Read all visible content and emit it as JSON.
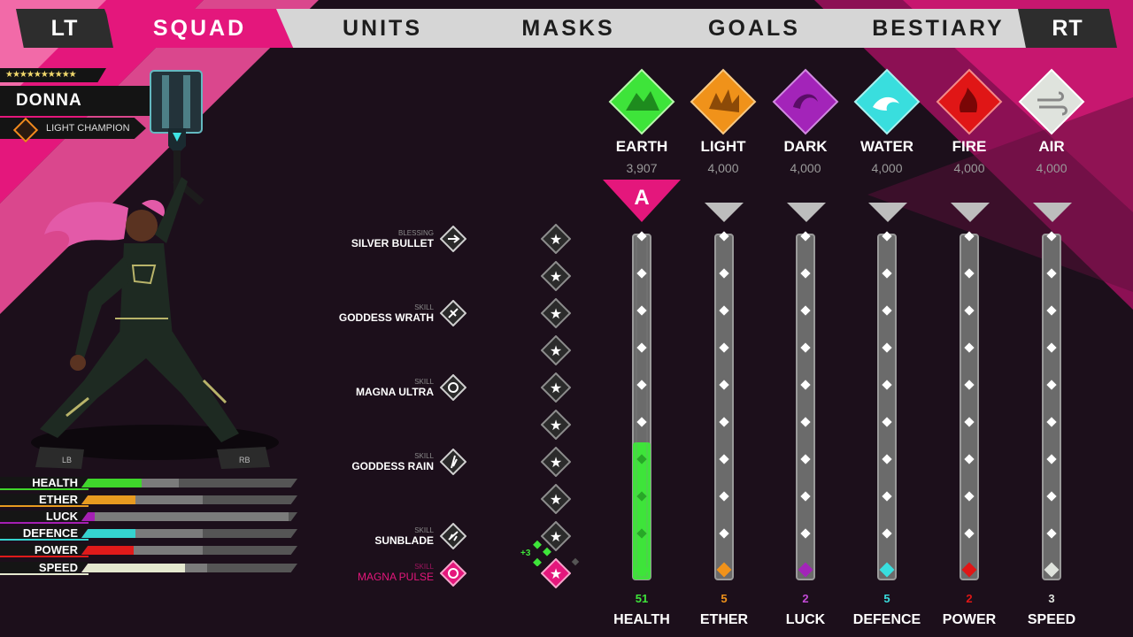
{
  "tabs": [
    {
      "label": "LT",
      "style": "dark"
    },
    {
      "label": "SQUAD",
      "style": "active"
    },
    {
      "label": "UNITS",
      "style": "light"
    },
    {
      "label": "MASKS",
      "style": "light"
    },
    {
      "label": "GOALS",
      "style": "light"
    },
    {
      "label": "BESTIARY",
      "style": "light"
    },
    {
      "label": "RT",
      "style": "dark"
    }
  ],
  "character": {
    "stars": "★★★★★★★★★★",
    "name": "DONNA",
    "class": "LIGHT CHAMPION",
    "lb": "LB",
    "rb": "RB"
  },
  "stat_bars": [
    {
      "label": "HEALTH",
      "color": "#3fd62b",
      "fill": 0.28,
      "fill2": 0.45
    },
    {
      "label": "ETHER",
      "color": "#e89a20",
      "fill": 0.25,
      "fill2": 0.56
    },
    {
      "label": "LUCK",
      "color": "#a51fb4",
      "fill": 0.06,
      "fill2": 0.96
    },
    {
      "label": "DEFENCE",
      "color": "#35d3cf",
      "fill": 0.25,
      "fill2": 0.56
    },
    {
      "label": "POWER",
      "color": "#e01a1a",
      "fill": 0.24,
      "fill2": 0.56
    },
    {
      "label": "SPEED",
      "color": "#e5e8cf",
      "fill": 0.48,
      "fill2": 0.58
    }
  ],
  "skills": [
    {
      "kind": "BLESSING",
      "name": "SILVER BULLET",
      "highlight": false
    },
    {
      "kind": "SKILL",
      "name": "GODDESS WRATH",
      "highlight": false
    },
    {
      "kind": "SKILL",
      "name": "MAGNA ULTRA",
      "highlight": false
    },
    {
      "kind": "SKILL",
      "name": "GODDESS RAIN",
      "highlight": false
    },
    {
      "kind": "SKILL",
      "name": "SUNBLADE",
      "highlight": false
    },
    {
      "kind": "SKILL",
      "name": "MAGNA PULSE",
      "highlight": true
    }
  ],
  "progress_bonus": "+3",
  "elements": [
    {
      "name": "EARTH",
      "value": "3,907",
      "color": "#3ee43a",
      "rank": "A"
    },
    {
      "name": "LIGHT",
      "value": "4,000",
      "color": "#f0921a",
      "rank": ""
    },
    {
      "name": "DARK",
      "value": "4,000",
      "color": "#a324b9",
      "rank": ""
    },
    {
      "name": "WATER",
      "value": "4,000",
      "color": "#39dede",
      "rank": ""
    },
    {
      "name": "FIRE",
      "value": "4,000",
      "color": "#e01616",
      "rank": ""
    },
    {
      "name": "AIR",
      "value": "4,000",
      "color": "#dfe3dd",
      "rank": ""
    }
  ],
  "columns": [
    {
      "number": "51",
      "stat": "HEALTH",
      "color": "#3ee43a",
      "fill": 0.4
    },
    {
      "number": "5",
      "stat": "ETHER",
      "color": "#f0921a",
      "fill": 0
    },
    {
      "number": "2",
      "stat": "LUCK",
      "color": "#a324b9",
      "fill": 0
    },
    {
      "number": "5",
      "stat": "DEFENCE",
      "color": "#39dede",
      "fill": 0
    },
    {
      "number": "2",
      "stat": "POWER",
      "color": "#e01616",
      "fill": 0
    },
    {
      "number": "3",
      "stat": "SPEED",
      "color": "#dfe3dd",
      "fill": 0
    }
  ]
}
